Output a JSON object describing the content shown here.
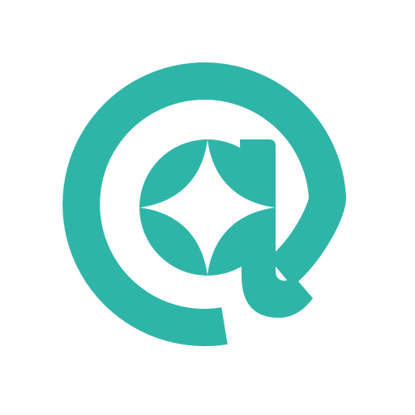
{
  "logo": {
    "icon_name": "at-sign-sparkle-icon",
    "colors": {
      "brand": "#2FB5A8",
      "background": "#FFFFFF"
    }
  }
}
